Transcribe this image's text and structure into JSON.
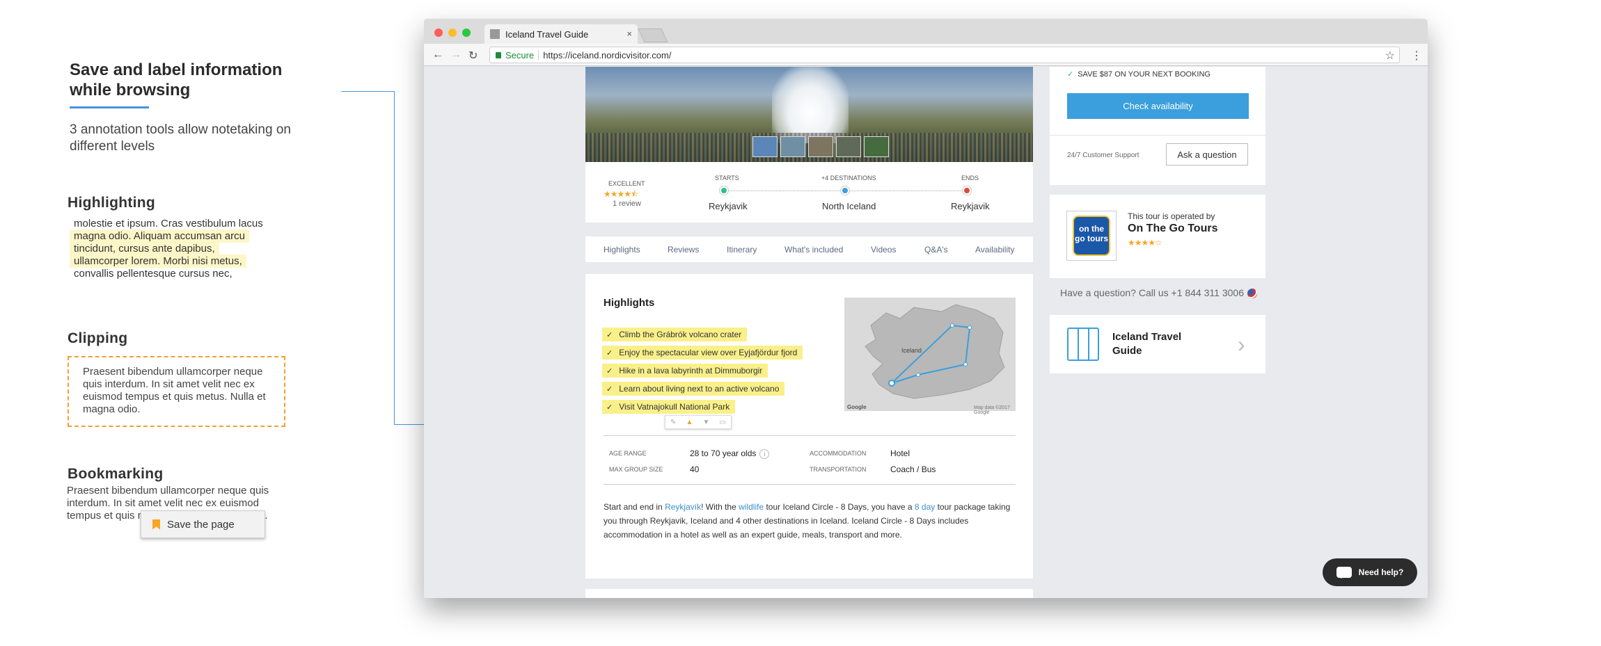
{
  "annotations": {
    "title": "Save and label information while browsing",
    "subtitle": "3 annotation tools allow notetaking on different levels",
    "highlighting": {
      "heading": "Highlighting",
      "lines": [
        {
          "text": "molestie et ipsum. Cras vestibulum lacus",
          "highlighted": false
        },
        {
          "text": "magna odio. Aliquam accumsan arcu",
          "highlighted": true
        },
        {
          "text": "tincidunt, cursus ante dapibus,",
          "highlighted": true
        },
        {
          "text": "ullamcorper lorem. Morbi nisi metus,",
          "highlighted": true
        },
        {
          "text": "convallis pellentesque cursus nec,",
          "highlighted": false
        }
      ]
    },
    "clipping": {
      "heading": "Clipping",
      "text": "Praesent bibendum ullamcorper neque quis interdum. In sit amet velit nec ex euismod tempus et quis metus. Nulla et magna odio."
    },
    "bookmarking": {
      "heading": "Bookmarking",
      "text": "Praesent bibendum ullamcorper neque quis interdum. In sit amet velit nec ex euismod tempus et quis metus. Nulla et magna odio.",
      "save_label": "Save the page"
    }
  },
  "browser": {
    "tab_title": "Iceland Travel Guide",
    "tab_close": "×",
    "secure_label": "Secure",
    "url": "https://iceland.nordicvisitor.com/"
  },
  "tour": {
    "rating_label": "EXCELLENT",
    "rating_stars": "★★★★⯪",
    "reviews": "1 review",
    "starts_label": "STARTS",
    "starts_place": "Reykjavik",
    "dest_label": "+4 DESTINATIONS",
    "dest_place": "North Iceland",
    "ends_label": "ENDS",
    "ends_place": "Reykjavik",
    "tabs": [
      "Highlights",
      "Reviews",
      "Itinerary",
      "What's included",
      "Videos",
      "Q&A's",
      "Availability"
    ],
    "highlights_title": "Highlights",
    "highlights": [
      "Climb the Grábrók volcano crater",
      "Enjoy the spectacular view over Eyjafjördur fjord",
      "Hike in a lava labyrinth at Dimmuborgir",
      "Learn about living next to an active volcano",
      "Visit Vatnajokull National Park"
    ],
    "map_label": "Iceland",
    "map_google": "Google",
    "map_credit": "Map data ©2017 Google",
    "details": {
      "age_label": "AGE RANGE",
      "age_value": "28 to 70 year olds",
      "group_label": "MAX GROUP SIZE",
      "group_value": "40",
      "accom_label": "ACCOMMODATION",
      "accom_value": "Hotel",
      "transport_label": "TRANSPORTATION",
      "transport_value": "Coach / Bus"
    },
    "description": {
      "p1": "Start and end in ",
      "link1": "Reykjavík",
      "p2": "! With the ",
      "link2": "wildlife",
      "p3": " tour Iceland Circle - 8 Days, you have a ",
      "link3": "8 day",
      "p4": " tour package taking you through Reykjavik, Iceland and 4 other destinations in Iceland. Iceland Circle - 8 Days includes accommodation in a hotel as well as an expert guide, meals, transport and more."
    }
  },
  "sidebar": {
    "save_text": "SAVE $87 ON YOUR NEXT BOOKING",
    "check_label": "Check availability",
    "support_text": "24/7 Customer Support",
    "ask_label": "Ask a question",
    "operator_small": "This tour is operated by",
    "operator_name": "On The Go Tours",
    "operator_stars": "★★★★☆",
    "logo_text": "on the go tours",
    "question_text": "Have a question? Call us +1 844 311 3006",
    "guide_title": "Iceland Travel Guide",
    "need_help": "Need help?"
  },
  "colors": {
    "accent": "#3a9fdc",
    "highlight": "#f9f08a",
    "clip_border": "#f0a030",
    "bookmark": "#f5a623",
    "secure": "#1e8c3a"
  }
}
